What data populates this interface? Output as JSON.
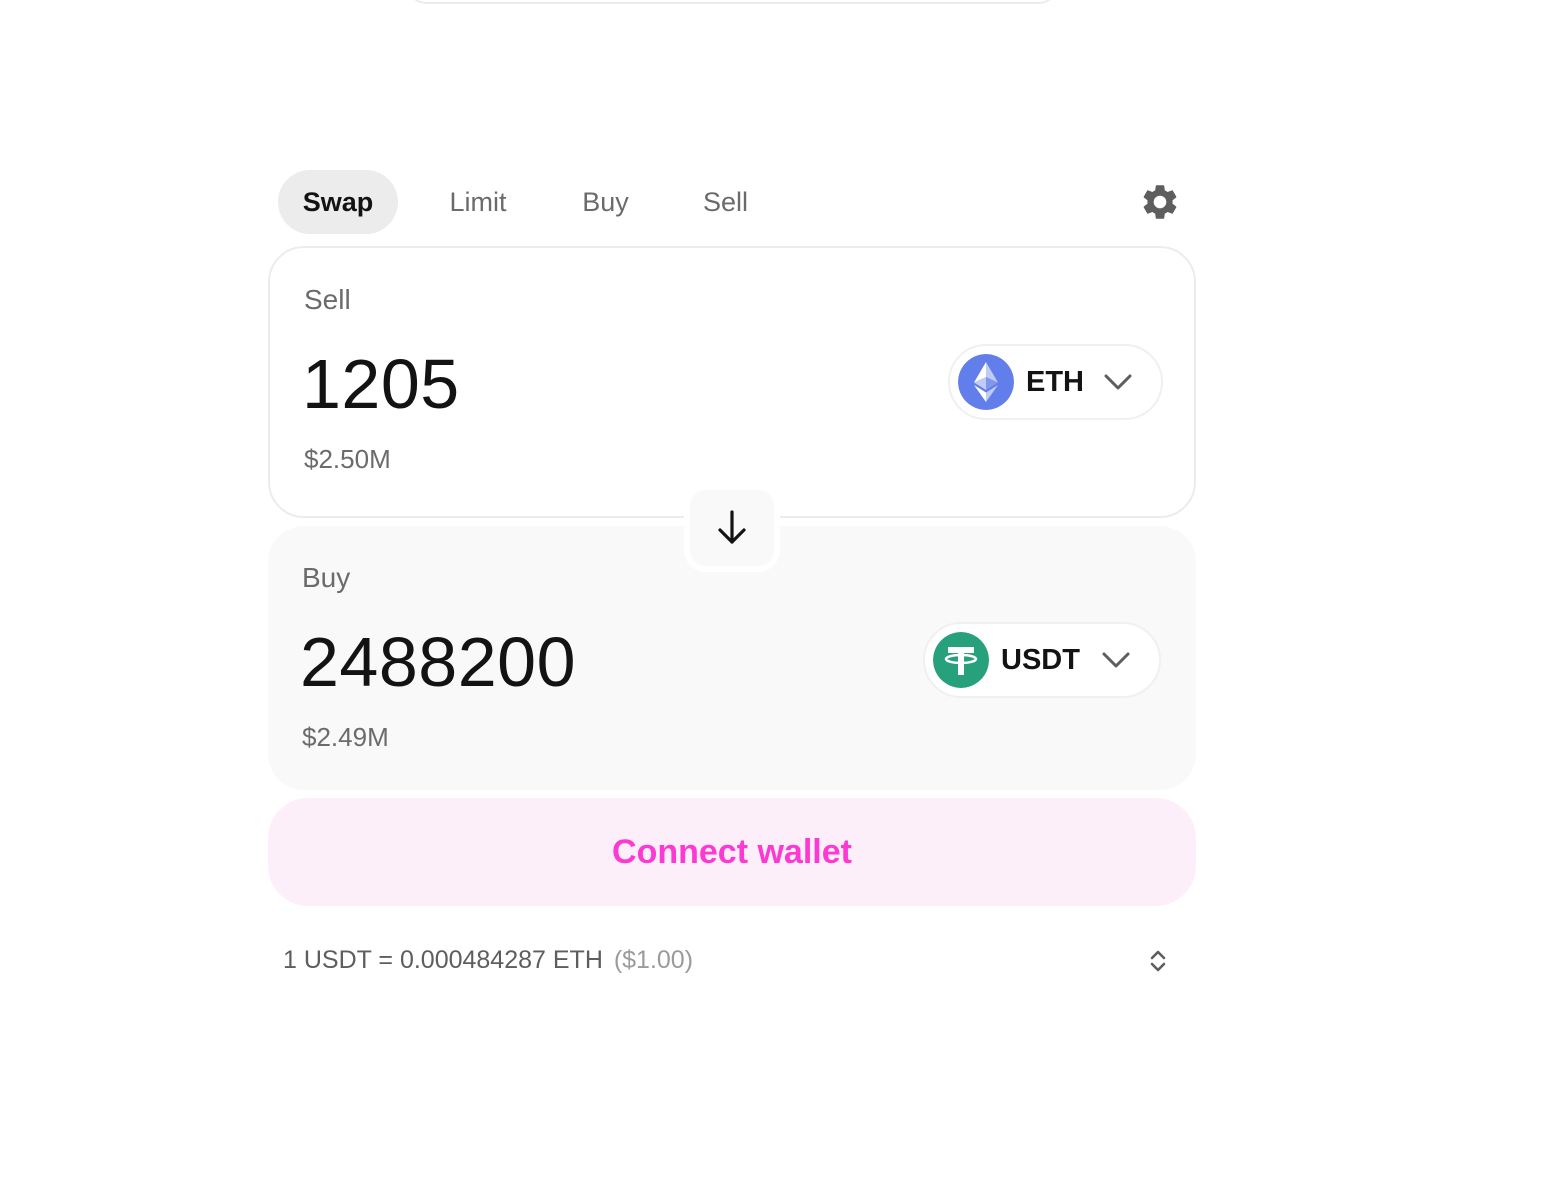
{
  "tabs": [
    {
      "label": "Swap",
      "active": true
    },
    {
      "label": "Limit",
      "active": false
    },
    {
      "label": "Buy",
      "active": false
    },
    {
      "label": "Sell",
      "active": false
    }
  ],
  "settings_icon": "gear-icon",
  "sell_panel": {
    "label": "Sell",
    "amount": "1205",
    "usd_value": "$2.50M",
    "token": {
      "symbol": "ETH",
      "icon": "eth-logo-icon",
      "color": "#627EEA"
    }
  },
  "switch_icon": "arrow-down-icon",
  "buy_panel": {
    "label": "Buy",
    "amount": "2488200",
    "usd_value": "$2.49M",
    "token": {
      "symbol": "USDT",
      "icon": "usdt-logo-icon",
      "color": "#26A17B"
    }
  },
  "connect_button": {
    "label": "Connect wallet",
    "text_color": "#FC39D2",
    "bg_color": "#FDEFFA"
  },
  "rate": {
    "text": "1 USDT = 0.000484287 ETH",
    "usd": "($1.00)"
  },
  "expand_icon": "chevron-up-down-icon"
}
